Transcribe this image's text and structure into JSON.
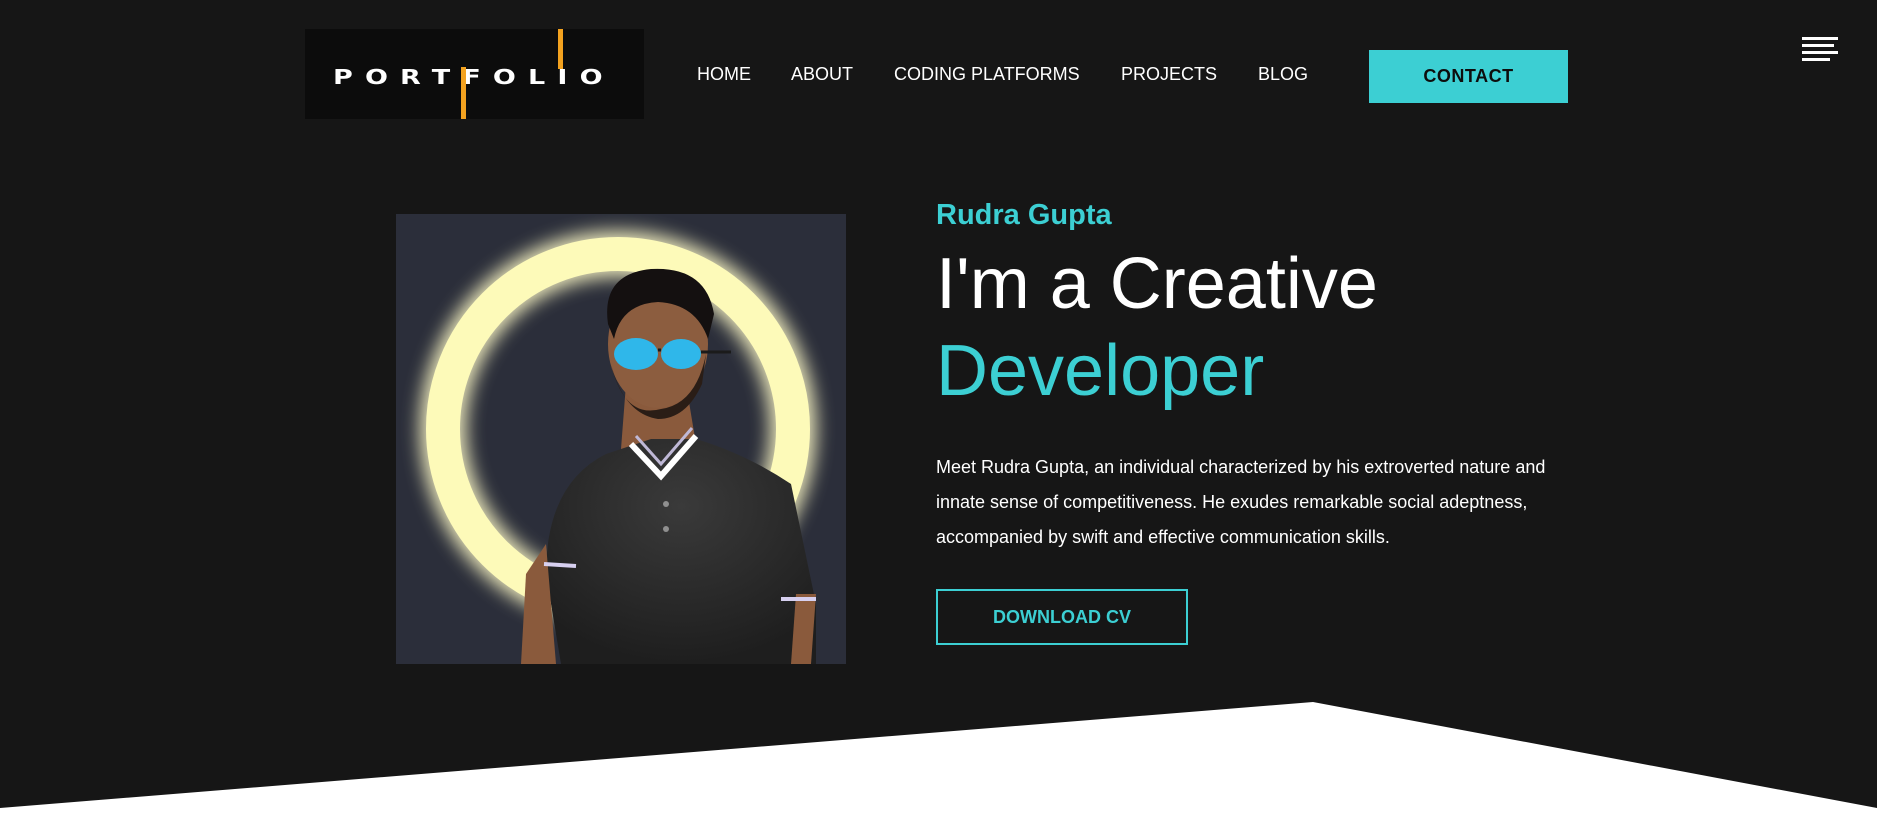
{
  "header": {
    "logo_text": "PORTFOLIO",
    "nav": [
      {
        "label": "HOME"
      },
      {
        "label": "ABOUT"
      },
      {
        "label": "CODING PLATFORMS"
      },
      {
        "label": "PROJECTS"
      },
      {
        "label": "BLOG"
      }
    ],
    "contact_label": "CONTACT",
    "menu_icon": "hamburger-menu-icon"
  },
  "hero": {
    "name": "Rudra Gupta",
    "headline_line1": "I'm a Creative",
    "headline_line2": "Developer",
    "bio": "Meet Rudra Gupta, an individual characterized by his extroverted nature and innate sense of competitiveness. He exudes remarkable social adeptness, accompanied by swift and effective communication skills.",
    "cv_label": "DOWNLOAD CV"
  },
  "colors": {
    "background": "#161616",
    "accent": "#3ccfd3",
    "logo_accent": "#f3a21f",
    "text": "#ffffff"
  }
}
